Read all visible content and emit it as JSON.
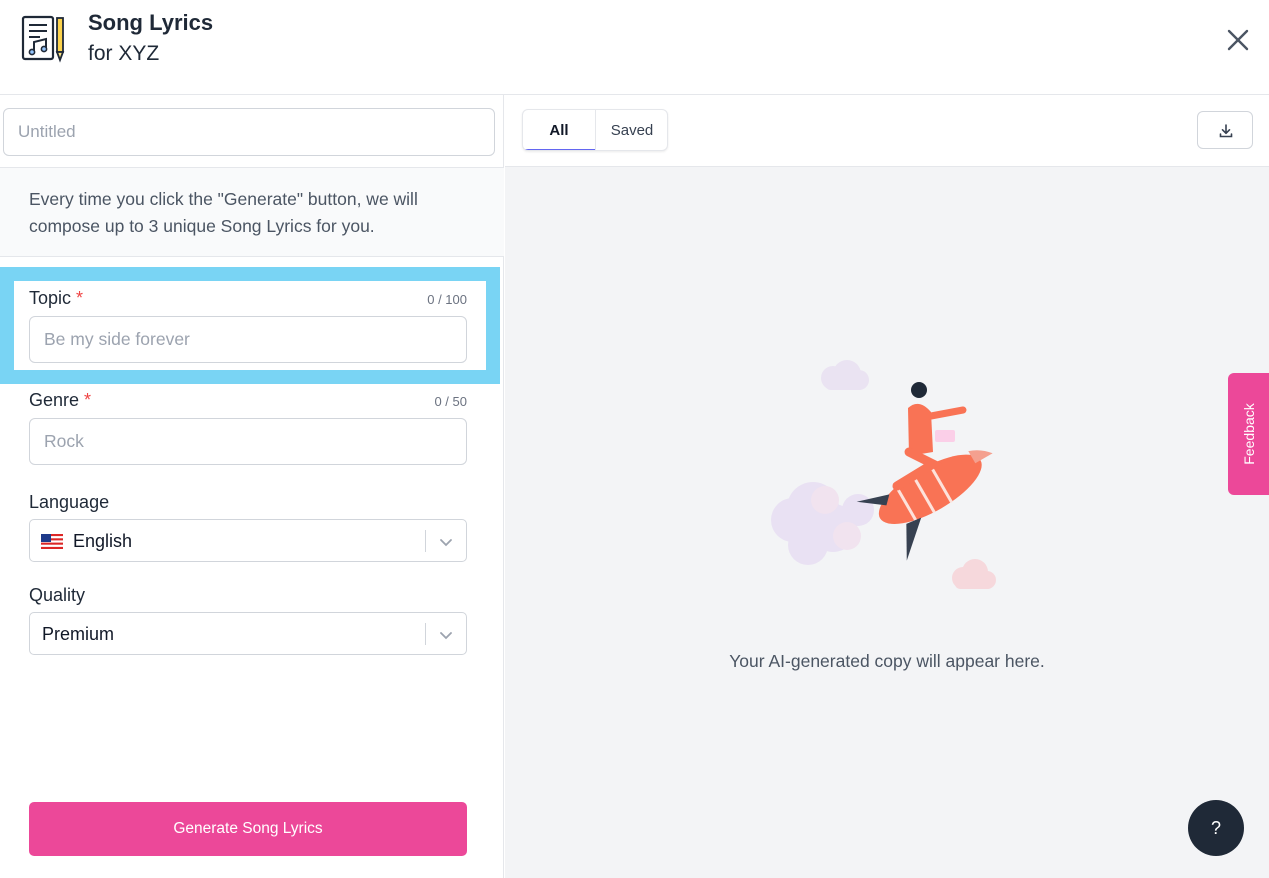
{
  "header": {
    "title": "Song Lyrics",
    "subtitle": "for XYZ",
    "icon": "song-sheet-icon",
    "close_icon": "close-icon"
  },
  "form": {
    "document_name_placeholder": "Untitled",
    "info_text": "Every time you click the \"Generate\" button, we will compose up to 3 unique Song Lyrics for you.",
    "topic": {
      "label": "Topic",
      "required_mark": "*",
      "counter": "0 / 100",
      "placeholder": "Be my side forever"
    },
    "genre": {
      "label": "Genre",
      "required_mark": "*",
      "counter": "0 / 50",
      "placeholder": "Rock"
    },
    "language": {
      "label": "Language",
      "value": "English",
      "flag_icon": "us-flag-icon"
    },
    "quality": {
      "label": "Quality",
      "value": "Premium"
    },
    "generate_label": "Generate Song Lyrics"
  },
  "output": {
    "tabs": [
      {
        "label": "All",
        "active": true
      },
      {
        "label": "Saved",
        "active": false
      }
    ],
    "download_icon": "download-icon",
    "empty_message": "Your AI-generated copy will appear here."
  },
  "feedback_label": "Feedback",
  "help_label": "?",
  "colors": {
    "accent_pink": "#ec4899",
    "highlight_blue": "#79d4f4",
    "tab_indicator": "#6366f1",
    "help_bg": "#1f2937"
  }
}
